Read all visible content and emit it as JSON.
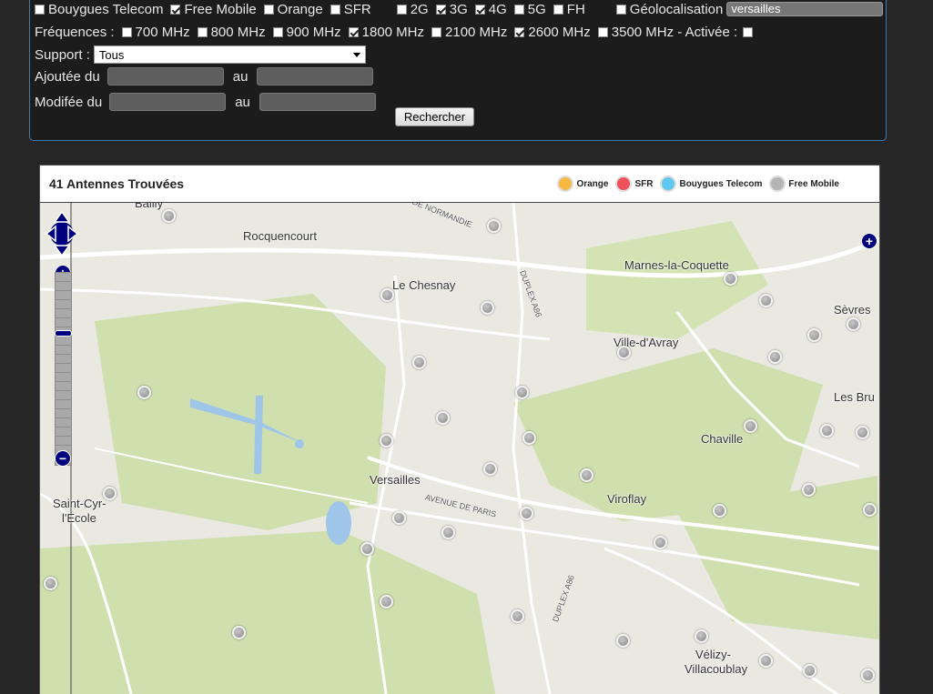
{
  "filters": {
    "operators": [
      {
        "label": "Bouygues Telecom",
        "checked": false
      },
      {
        "label": "Free Mobile",
        "checked": true
      },
      {
        "label": "Orange",
        "checked": false
      },
      {
        "label": "SFR",
        "checked": false
      }
    ],
    "technologies": [
      {
        "label": "2G",
        "checked": false
      },
      {
        "label": "3G",
        "checked": true
      },
      {
        "label": "4G",
        "checked": true
      },
      {
        "label": "5G",
        "checked": false
      },
      {
        "label": "FH",
        "checked": false
      }
    ],
    "geolocation": {
      "label": "Géolocalisation",
      "checked": false,
      "value": "versailles"
    },
    "frequencies_label": "Fréquences :",
    "frequencies": [
      {
        "label": "700 MHz",
        "checked": false
      },
      {
        "label": "800 MHz",
        "checked": false
      },
      {
        "label": "900 MHz",
        "checked": false
      },
      {
        "label": "1800 MHz",
        "checked": true
      },
      {
        "label": "2100 MHz",
        "checked": false
      },
      {
        "label": "2600 MHz",
        "checked": true
      },
      {
        "label": "3500 MHz - Activée :",
        "checked": false
      }
    ],
    "support_label": "Support :",
    "support_value": "Tous",
    "added_label": "Ajoutée du",
    "modified_label": "Modifée du",
    "au_label": "au",
    "search_button": "Rechercher"
  },
  "results": {
    "count_text": "41 Antennes Trouvées",
    "legend": [
      {
        "label": "Orange",
        "color": "#f5b942"
      },
      {
        "label": "SFR",
        "color": "#f0505a"
      },
      {
        "label": "Bouygues Telecom",
        "color": "#5ec8f0"
      },
      {
        "label": "Free Mobile",
        "color": "#b4b4b4"
      }
    ]
  },
  "map": {
    "places": [
      "Bailly",
      "Rocquencourt",
      "Le Chesnay",
      "Marnes-la-Coquette",
      "Sèvres",
      "Ville-d'Avray",
      "Les Bru",
      "Chaville",
      "Versailles",
      "Viroflay",
      "Saint-Cyr-",
      "l'École",
      "Vélizy-",
      "Villacoublay"
    ],
    "roads": [
      "ROUTE DE NORMANDIE",
      "DUPLEX A86",
      "AVENUE DE PARIS",
      "DUPLEX A86"
    ],
    "zoom_in": "+",
    "zoom_out": "−",
    "layer_switcher": "+"
  }
}
